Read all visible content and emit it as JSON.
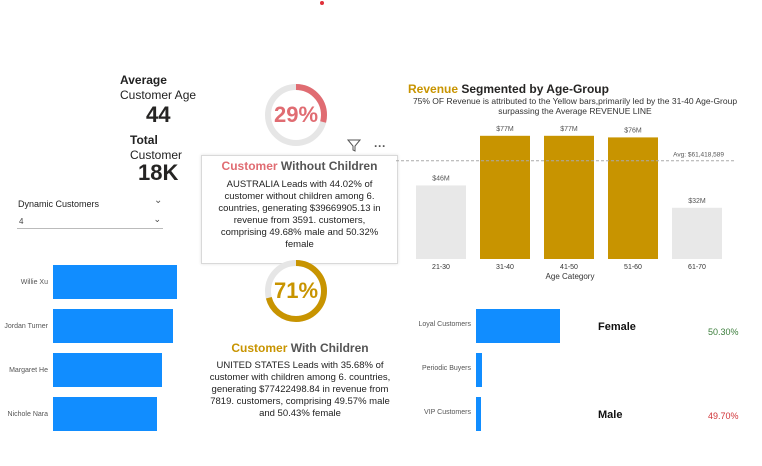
{
  "kpis": {
    "avg_age_title": "Average",
    "avg_age_subtitle": "Customer Age",
    "avg_age_value": "44",
    "total_title": "Total",
    "total_subtitle": "Customer",
    "total_value": "18K"
  },
  "slicer": {
    "label": "Dynamic Customers",
    "value": "4"
  },
  "top_customers": {
    "items": [
      {
        "name": "Willie Xu",
        "share": 1.0
      },
      {
        "name": "Jordan Turner",
        "share": 0.97
      },
      {
        "name": "Margaret He",
        "share": 0.88
      },
      {
        "name": "Nichole Nara",
        "share": 0.84
      }
    ]
  },
  "without_children": {
    "percent": "29%",
    "percent_value": 29,
    "title_highlight": "Customer",
    "title_rest": " Without Children",
    "body": "AUSTRALIA Leads with 44.02% of customer without children among 6. countries, generating $39669905.13 in revenue from 3591. customers, comprising 49.68% male and 50.32% female",
    "color": "#e06c72"
  },
  "with_children": {
    "percent": "71%",
    "percent_value": 71,
    "title_highlight": "Customer",
    "title_rest": " With Children",
    "body": "UNITED STATES Leads with 35.68% of customer with children among 6. countries, generating $77422498.84 in revenue from 7819. customers, comprising 49.57% male and 50.43% female",
    "color": "#c89400"
  },
  "toolbar": {
    "filter_icon": "filter-icon",
    "more_icon": "more-options-icon",
    "more_label": "···"
  },
  "revenue_chart": {
    "title_highlight": "Revenue",
    "title_rest": " Segmented by Age-Group",
    "subtitle_line1": "75% OF Revenue is attributed to the Yellow bars,primarily led by the 31-40 Age-Group",
    "subtitle_line2": "surpassing the Average REVENUE LINE",
    "avg_label": "Avg: $61,418,589",
    "xlabel": "Age Category"
  },
  "chart_data": {
    "type": "bar",
    "categories": [
      "21-30",
      "31-40",
      "41-50",
      "51-60",
      "61-70"
    ],
    "values": [
      46,
      77,
      77,
      76,
      32
    ],
    "value_labels": [
      "$46M",
      "$77M",
      "$77M",
      "$76M",
      "$32M"
    ],
    "highlight": [
      false,
      true,
      true,
      true,
      false
    ],
    "average": 61.418589,
    "ylim": [
      0,
      80
    ],
    "xlabel": "Age Category",
    "colors": {
      "highlight": "#c89400",
      "normal": "#e8e8e8",
      "average_line": "#aaaaaa"
    }
  },
  "segments": {
    "items": [
      {
        "label": "Loyal Customers",
        "share": 1.0
      },
      {
        "label": "Periodic Buyers",
        "share": 0.07
      },
      {
        "label": "VIP Customers",
        "share": 0.05
      }
    ]
  },
  "gender": {
    "female_label": "Female",
    "female_pct": "50.30%",
    "female_color": "#3a7d3a",
    "male_label": "Male",
    "male_pct": "49.70%",
    "male_color": "#d13438"
  },
  "colors": {
    "accent_blue": "#118dff",
    "gold": "#c89400",
    "rose": "#e06c72"
  }
}
